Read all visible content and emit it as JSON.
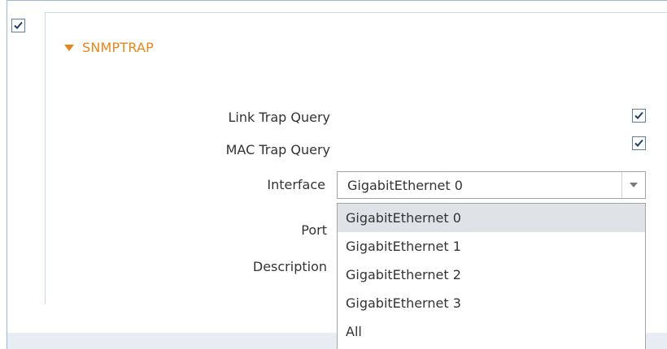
{
  "section": {
    "title": "SNMPTRAP",
    "enabled_checked": true
  },
  "fields": {
    "link_trap_label": "Link Trap Query",
    "link_trap_checked": true,
    "mac_trap_label": "MAC Trap Query",
    "mac_trap_checked": true,
    "interface_label": "Interface",
    "interface_value": "GigabitEthernet 0",
    "port_label": "Port",
    "description_label": "Description"
  },
  "dropdown": {
    "options": [
      "GigabitEthernet 0",
      "GigabitEthernet 1",
      "GigabitEthernet 2",
      "GigabitEthernet 3",
      "All"
    ],
    "highlighted": "GigabitEthernet 0"
  },
  "colors": {
    "accent": "#e8861a",
    "checkbox_border": "#5b7fa6",
    "highlight": "#dfe3e8"
  }
}
